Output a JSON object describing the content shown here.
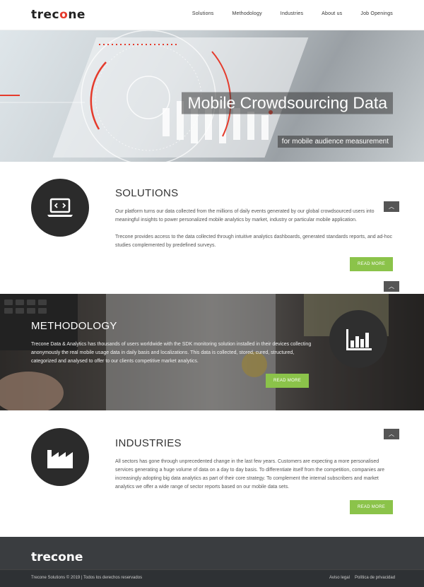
{
  "header": {
    "logo_prefix": "trec",
    "logo_accent": "o",
    "logo_suffix": "ne",
    "nav": [
      "Solutions",
      "Methodology",
      "Industries",
      "About us",
      "Job Openings"
    ]
  },
  "hero": {
    "title": "Mobile Crowdsourcing Data",
    "subtitle": "for mobile audience measurement"
  },
  "solutions": {
    "title": "SOLUTIONS",
    "p1": "Our platform turns our data collected from the millions of daily events generated by our global crowdsourced users into meaningful insights to power personalized mobile analytics by market, industry or particular mobile application.",
    "p2": "Trecone provides access to the data collected through intuitive analytics dashboards, generated standards reports, and ad-hoc studies complemented by predefined surveys.",
    "button": "READ MORE",
    "icon": "laptop-code-icon"
  },
  "methodology": {
    "title": "METHODOLOGY",
    "text": "Trecone Data & Analytics has thousands of users worldwide with the SDK monitoring solution installed in their devices collecting anonymously the real mobile usage data in daily basis and localizations. This data is collected, stored, cured, structured, categorized and analysed to offer to our clients competitive market analytics.",
    "button": "READ MORE",
    "icon": "bar-chart-icon"
  },
  "industries": {
    "title": "INDUSTRIES",
    "text": "All sectors has gone through unprecedented change in the last few years. Customers are expecting a more personalised services generating a huge volume of data on a day to day basis. To differentiate itself from the competition, companies are increasingly adopting big data analytics as part of their core strategy. To complement the internal subscribers and market analytics we offer a wide range of sector reports based on our mobile data sets.",
    "button": "READ MORE",
    "icon": "factory-icon"
  },
  "footer": {
    "logo": "trecone",
    "copyright": "Trecone Solutions © 2019 | Todos los derechos reservados",
    "legal": "Aviso legal",
    "privacy": "Política de privacidad"
  },
  "colors": {
    "accent": "#e53b2c",
    "button": "#8bc34a",
    "dark": "#2b2b2b",
    "footer": "#3a3d40"
  }
}
